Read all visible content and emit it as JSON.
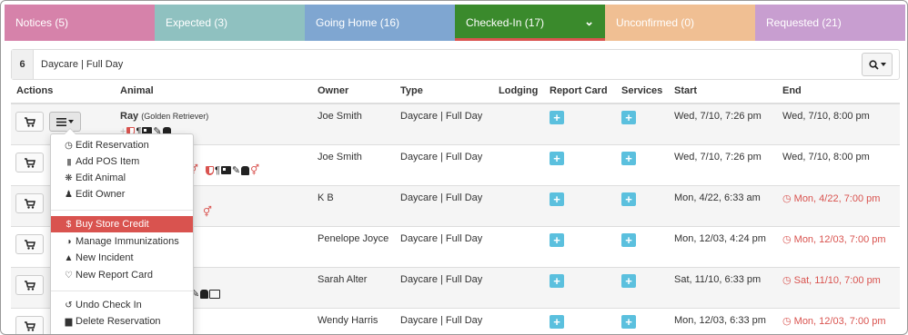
{
  "tabs": [
    {
      "label": "Notices (5)",
      "color": "#d682aa"
    },
    {
      "label": "Expected (3)",
      "color": "#8fc1c0"
    },
    {
      "label": "Going Home (16)",
      "color": "#7fa6d1"
    },
    {
      "label": "Checked-In (17)",
      "color": "#3a8a2c"
    },
    {
      "label": "Unconfirmed (0)",
      "color": "#f0bf93"
    },
    {
      "label": "Requested (21)",
      "color": "#c89ed0"
    }
  ],
  "active_tab_chevron": "»",
  "filter": {
    "count": "6",
    "text": "Daycare | Full Day"
  },
  "columns": {
    "actions": "Actions",
    "animal": "Animal",
    "owner": "Owner",
    "type": "Type",
    "lodging": "Lodging",
    "report_card": "Report Card",
    "services": "Services",
    "start": "Start",
    "end": "End"
  },
  "rows": [
    {
      "animal": "Ray",
      "breed": "(Golden Retriever)",
      "owner": "Joe Smith",
      "type": "Daycare | Full Day",
      "start": "Wed, 7/10, 7:26 pm",
      "end": "Wed, 7/10, 8:00 pm",
      "overdue": false
    },
    {
      "animal": "",
      "breed": "",
      "owner": "Joe Smith",
      "type": "Daycare | Full Day",
      "start": "Wed, 7/10, 7:26 pm",
      "end": "Wed, 7/10, 8:00 pm",
      "overdue": false
    },
    {
      "animal": "",
      "breed": "",
      "owner": "K B",
      "type": "Daycare | Full Day",
      "start": "Mon, 4/22, 6:33 am",
      "end": "Mon, 4/22, 7:00 pm",
      "overdue": true
    },
    {
      "animal": "",
      "breed": "",
      "owner": "Penelope Joyce",
      "type": "Daycare | Full Day",
      "start": "Mon, 12/03, 4:24 pm",
      "end": "Mon, 12/03, 7:00 pm",
      "overdue": true
    },
    {
      "animal": "",
      "breed": "",
      "owner": "Sarah Alter",
      "type": "Daycare | Full Day",
      "start": "Sat, 11/10, 6:33 pm",
      "end": "Sat, 11/10, 7:00 pm",
      "overdue": true
    },
    {
      "animal": "",
      "breed": "",
      "owner": "Wendy Harris",
      "type": "Daycare | Full Day",
      "start": "Mon, 12/03, 6:33 pm",
      "end": "Mon, 12/03, 7:00 pm",
      "overdue": true
    }
  ],
  "menu": {
    "edit_reservation": "Edit Reservation",
    "add_pos_item": "Add POS Item",
    "edit_animal": "Edit Animal",
    "edit_owner": "Edit Owner",
    "buy_store_credit": "Buy Store Credit",
    "manage_immunizations": "Manage Immunizations",
    "new_incident": "New Incident",
    "new_report_card": "New Report Card",
    "undo_check_in": "Undo Check In",
    "delete_reservation": "Delete Reservation"
  },
  "icon_glyphs": {
    "clock": "◷",
    "barcode": "┃┃┃",
    "paw": "❋",
    "person": "♟",
    "dollar": "$",
    "shield": "◑",
    "warning": "▲",
    "heart": "♡",
    "undo": "↺",
    "trash": "▆",
    "plus": "+",
    "pilcrow": "¶",
    "pencil": "✎",
    "gender": "⚥",
    "cart": "🛒"
  },
  "colors": {
    "accent_red": "#d9534f",
    "plus_blue": "#5bc0de"
  }
}
